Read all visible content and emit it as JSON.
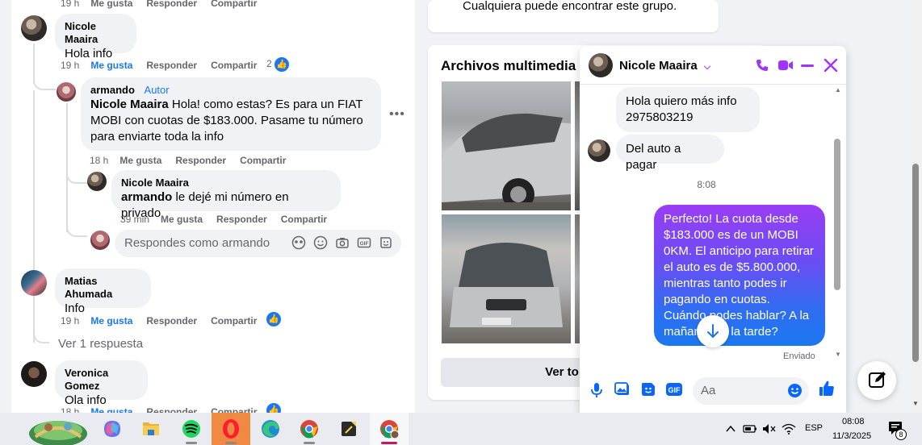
{
  "feed": {
    "top_actions": {
      "time": "19 h",
      "like": "Me gusta",
      "reply": "Responder",
      "share": "Compartir"
    },
    "comment1": {
      "name": "Nicole Maaira",
      "text": "Hola info",
      "time": "19 h",
      "like": "Me gusta",
      "reply": "Responder",
      "share": "Compartir",
      "reaction_count": "2"
    },
    "reply1": {
      "name": "armando",
      "badge": "Autor",
      "mention": "Nicole Maaira",
      "text": "Hola! como estas? Es para un FIAT MOBI con cuotas de $183.000. Pasame tu número para enviarte toda la info",
      "time": "18 h",
      "like": "Me gusta",
      "reply": "Responder",
      "share": "Compartir"
    },
    "reply2": {
      "name": "Nicole Maaira",
      "mention": "armando",
      "text": "le dejé mi número en privado",
      "time": "39 min",
      "like": "Me gusta",
      "reply": "Responder",
      "share": "Compartir"
    },
    "reply_box": {
      "placeholder": "Respondes como armando"
    },
    "comment2": {
      "name": "Matias Ahumada",
      "text": "Info",
      "time": "19 h",
      "like": "Me gusta",
      "reply": "Responder",
      "share": "Compartir",
      "more_replies": "Ver 1 respuesta"
    },
    "comment3": {
      "name": "Veronica Gomez",
      "text": "Ola info",
      "time": "18 h",
      "like": "Me gusta",
      "reply": "Responder",
      "share": "Compartir"
    }
  },
  "group": {
    "about_text": "Cualquiera puede encontrar este grupo.",
    "media_title": "Archivos multimedia re",
    "view_all": "Ver to"
  },
  "chat": {
    "contact": "Nicole Maaira",
    "msg1": "Hola quiero más info 2975803219",
    "msg2": "Del auto a pagar",
    "timestamp": "8:08",
    "msg3": "Perfecto! La cuota desde $183.000 es de un MOBI 0KM. El anticipo para retirar el auto es de $5.800.000, mientras tanto podes ir pagando en cuotas. Cuándo podes hablar? A la mañana o a la tarde?",
    "status": "Enviado",
    "input_placeholder": "Aa",
    "accent": "#a033ff"
  },
  "taskbar": {
    "apps": [
      "start-icon",
      "copilot-icon",
      "file-explorer-icon",
      "spotify-icon",
      "opera-icon",
      "edge-icon",
      "chrome-icon",
      "sticky-notes-icon",
      "chrome-profile-icon"
    ],
    "language": "ESP",
    "time": "08:08",
    "date": "11/3/2025",
    "notification_count": "8"
  }
}
